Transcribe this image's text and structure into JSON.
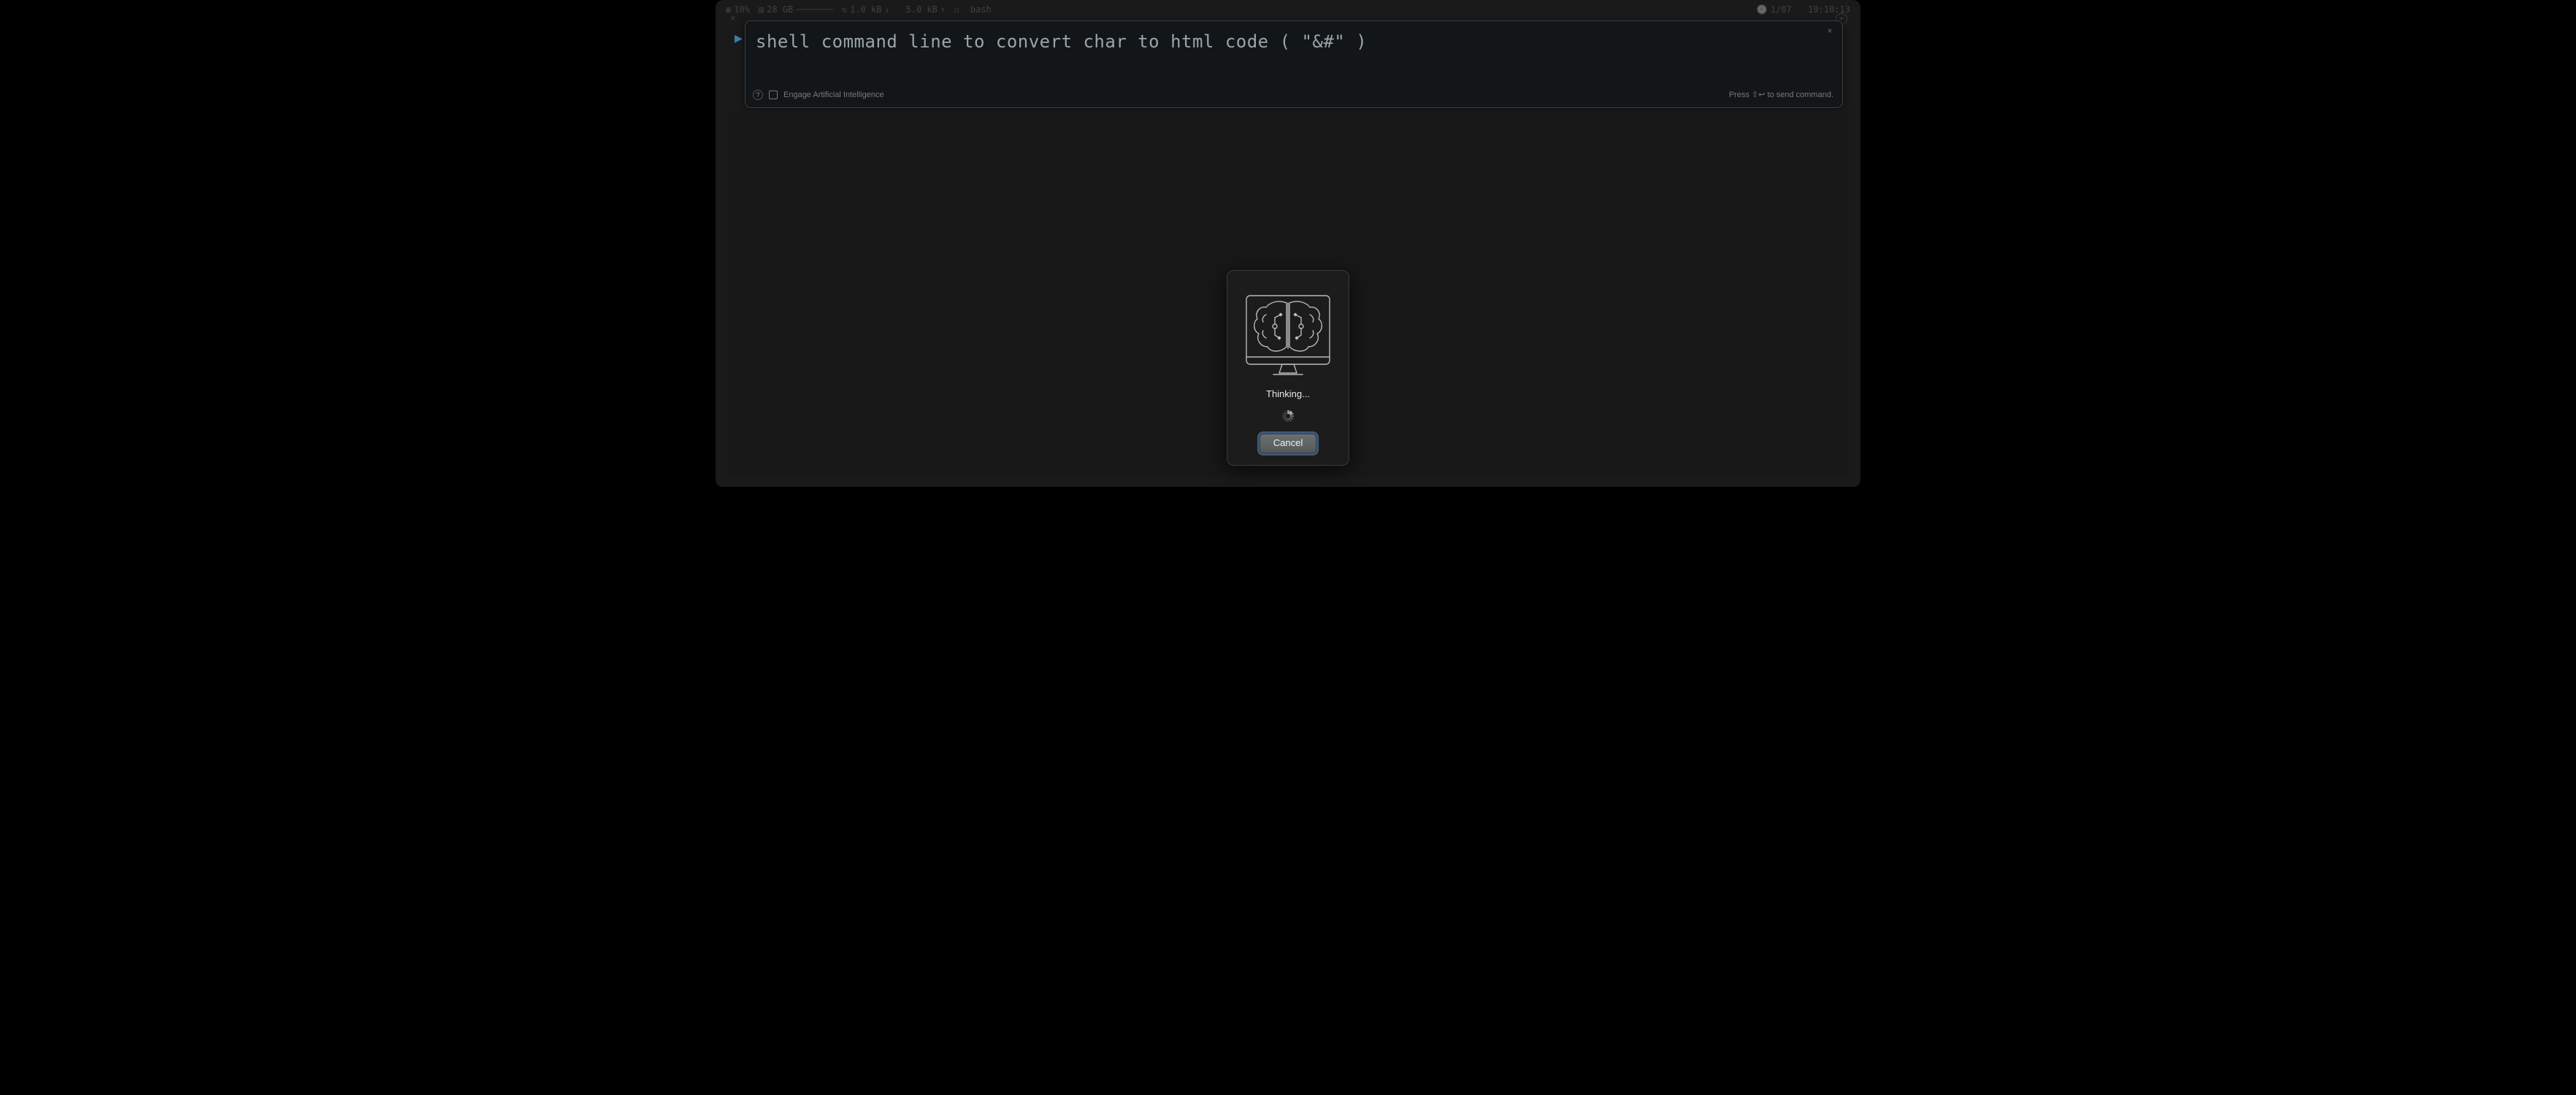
{
  "statusbar": {
    "cpu_pct": "10%",
    "mem": "28 GB",
    "net_down": "1.0 kB",
    "net_up": "5.0 kB",
    "shell": "bash",
    "date": "1/07",
    "time": "19:10:13"
  },
  "command": {
    "text": "shell command line to convert char to html code ( \"&#\" )"
  },
  "footer": {
    "ai_label": "Engage Artificial Intelligence",
    "hint": "Press ⇧↩ to send command."
  },
  "modal": {
    "status": "Thinking...",
    "cancel": "Cancel"
  }
}
